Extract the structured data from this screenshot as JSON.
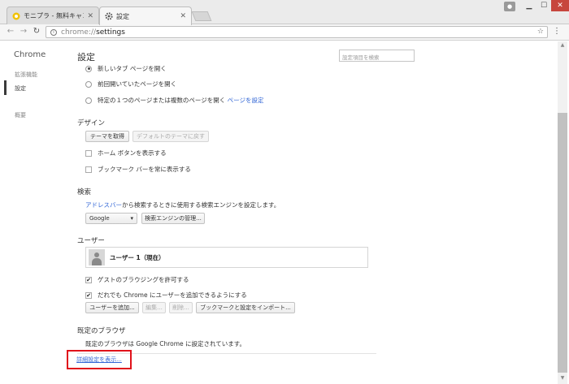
{
  "tabs": [
    {
      "label": "モニプラ - 無料キャンペー",
      "active": false
    },
    {
      "label": "設定",
      "active": true
    }
  ],
  "address": {
    "scheme": "chrome://",
    "host": "settings"
  },
  "sidebar": {
    "brand": "Chrome",
    "items": [
      {
        "label": "拡張機能"
      },
      {
        "label": "設定"
      },
      {
        "label": "概要"
      }
    ]
  },
  "header": {
    "title": "設定",
    "search_placeholder": "設定項目を検索"
  },
  "startup": {
    "options": [
      {
        "label": "新しいタブ ページを開く",
        "selected": true
      },
      {
        "label": "前回開いていたページを開く",
        "selected": false
      },
      {
        "label": "特定の１つのページまたは複数のページを開く",
        "link": "ページを設定",
        "selected": false
      }
    ]
  },
  "design": {
    "title": "デザイン",
    "get_theme": "テーマを取得",
    "reset_theme": "デフォルトのテーマに戻す",
    "home_button": "ホーム ボタンを表示する",
    "bookmarks_bar": "ブックマーク バーを常に表示する"
  },
  "search": {
    "title": "検索",
    "desc_link": "アドレスバー",
    "desc_text": "から検索するときに使用する検索エンジンを設定します。",
    "engine": "Google",
    "manage": "検索エンジンの管理..."
  },
  "users": {
    "title": "ユーザー",
    "current_user": "ユーザー 1（現在）",
    "guest": "ゲストのブラウジングを許可する",
    "anyone_add": "だれでも Chrome にユーザーを追加できるようにする",
    "add": "ユーザーを追加...",
    "edit": "編集...",
    "remove": "削除...",
    "import": "ブックマークと設定をインポート..."
  },
  "default_browser": {
    "title": "既定のブラウザ",
    "text": "既定のブラウザは Google Chrome に設定されています。"
  },
  "advanced_link": "詳細設定を表示..."
}
